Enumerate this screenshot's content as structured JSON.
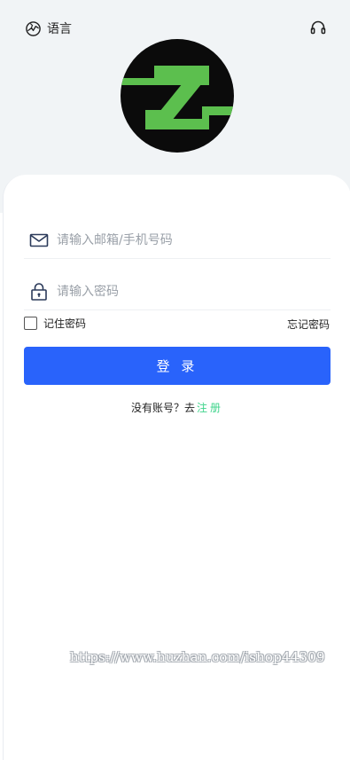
{
  "header": {
    "language_label": "语言",
    "language_icon": "globe-icon",
    "support_icon": "headset-icon"
  },
  "logo": {
    "icon": "z-logo-icon",
    "colors": {
      "background": "#0b0b0b",
      "mark": "#5cbf4e"
    }
  },
  "form": {
    "email_placeholder": "请输入邮箱/手机号码",
    "password_placeholder": "请输入密码",
    "remember_label": "记住密码",
    "forgot_label": "忘记密码",
    "login_button": "登 录",
    "no_account_text": "没有账号？去",
    "register_link": "注册"
  },
  "watermark": "https://www.huzhan.com/ishop44309",
  "colors": {
    "primary": "#2963fb",
    "register_link": "#3ed48b",
    "header_background": "#f1f4f6"
  }
}
